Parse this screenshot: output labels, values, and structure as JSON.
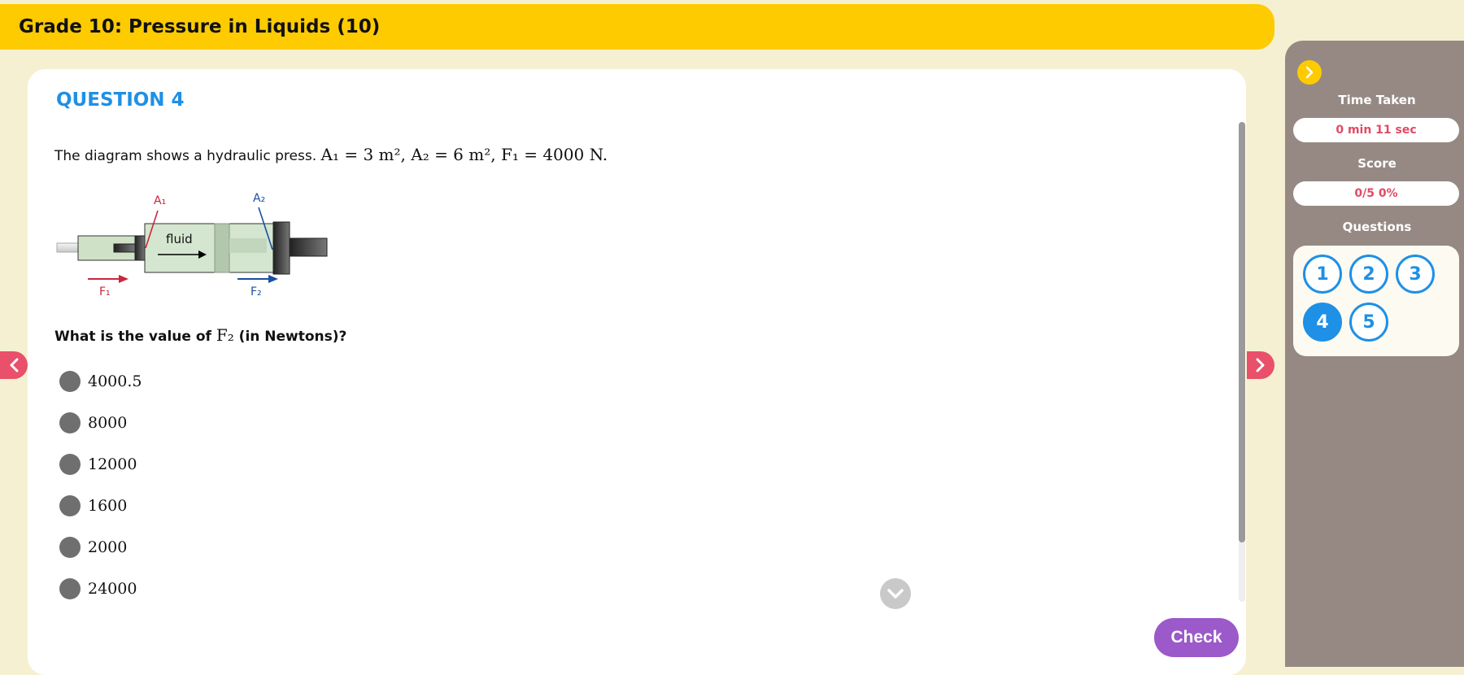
{
  "header": {
    "title": "Grade 10: Pressure in Liquids (10)"
  },
  "question": {
    "number_label": "QUESTION 4",
    "intro": "The diagram shows a hydraulic press. ",
    "given_math": "A₁ = 3 m², A₂ = 6 m², F₁ = 4000 N.",
    "ask_prefix": "What is the value of ",
    "ask_math": "F₂",
    "ask_suffix": " (in Newtons)?",
    "options": [
      "4000.5",
      "8000",
      "12000",
      "1600",
      "2000",
      "24000"
    ]
  },
  "diagram": {
    "label_a1": "A₁",
    "label_a2": "A₂",
    "label_fluid": "fluid",
    "label_f1": "F₁",
    "label_f2": "F₂"
  },
  "actions": {
    "check_label": "Check"
  },
  "sidebar": {
    "time_label": "Time Taken",
    "time_value": "0 min 11 sec",
    "score_label": "Score",
    "score_value": "0/5 0%",
    "questions_label": "Questions",
    "question_buttons": [
      "1",
      "2",
      "3",
      "4",
      "5"
    ],
    "active_question": "4"
  },
  "colors": {
    "header": "#fecb00",
    "accent_blue": "#1e90e6",
    "nav_red": "#e9506a",
    "check_purple": "#9b59c9",
    "sidebar": "#968983",
    "f1_red": "#c8283c",
    "f2_blue": "#1a4fa0"
  },
  "icons": {
    "nav_prev": "chevron-left-icon",
    "nav_next": "chevron-right-icon",
    "collapse": "chevron-right-icon",
    "scroll_down": "chevron-down-icon"
  }
}
